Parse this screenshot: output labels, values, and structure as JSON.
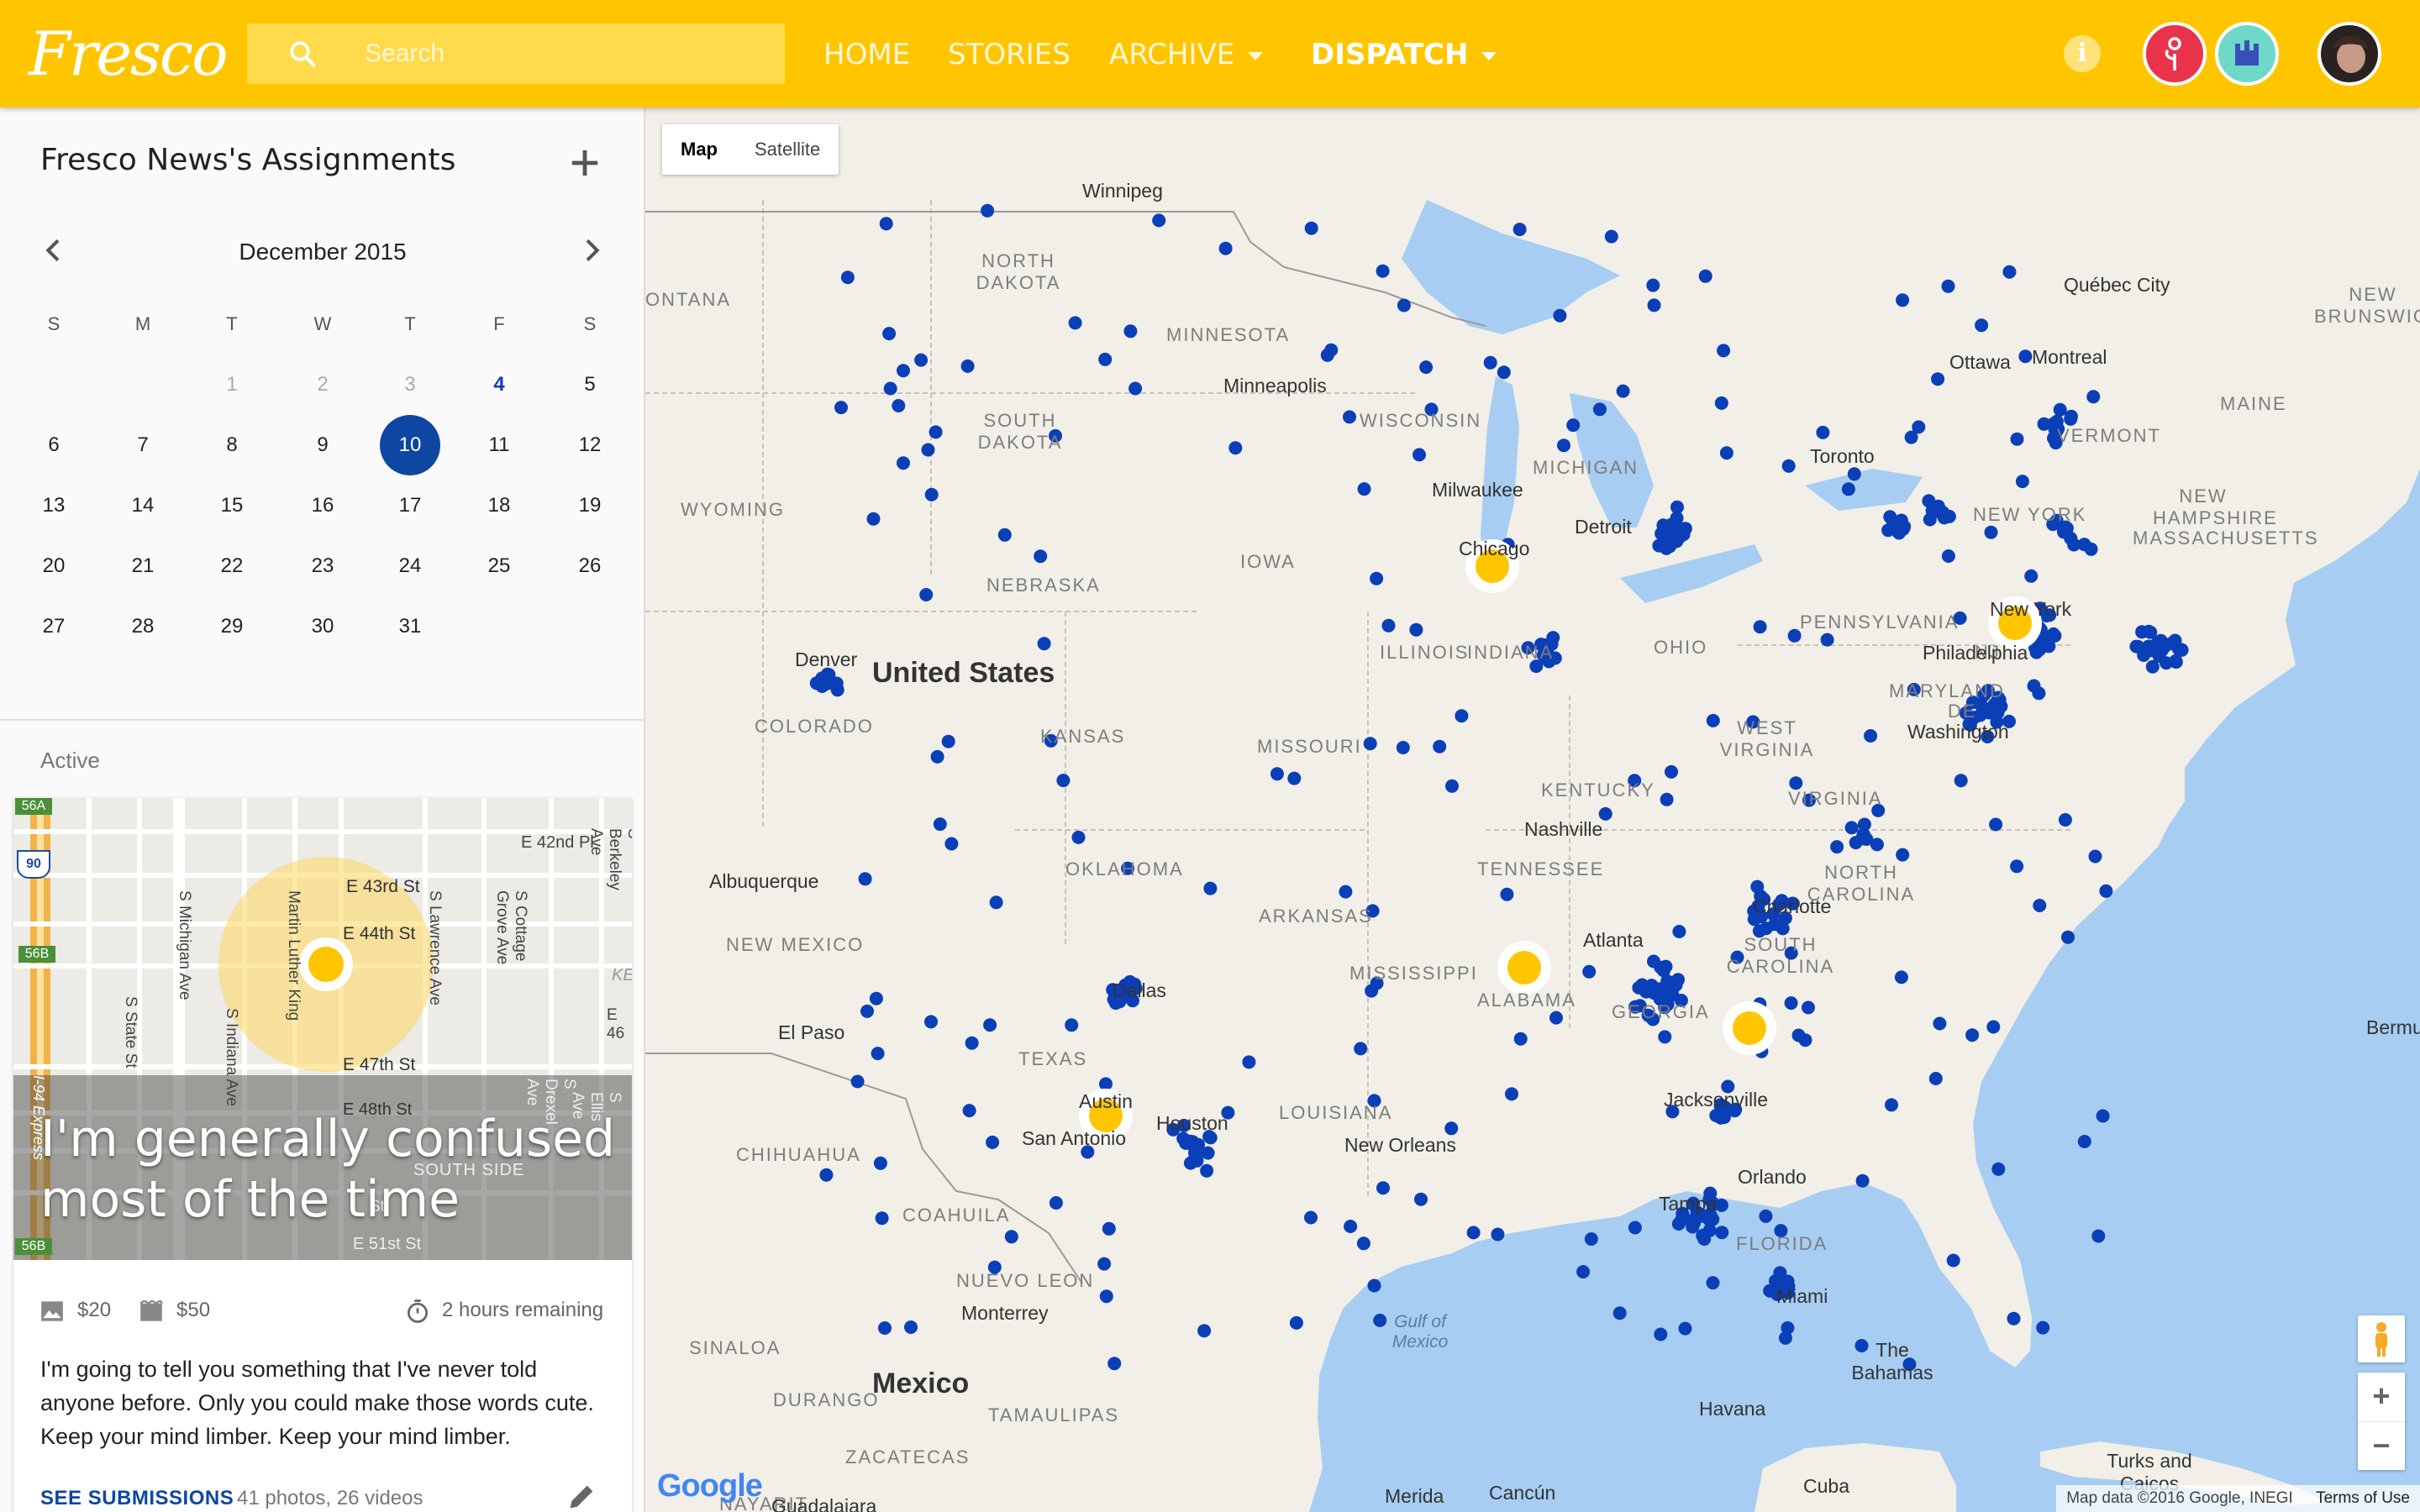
{
  "app": {
    "logo_text": "Fresco"
  },
  "header": {
    "search_placeholder": "Search",
    "nav": [
      {
        "label": "HOME",
        "active": false,
        "dropdown": false
      },
      {
        "label": "STORIES",
        "active": false,
        "dropdown": false
      },
      {
        "label": "ARCHIVE",
        "active": false,
        "dropdown": true
      },
      {
        "label": "DISPATCH",
        "active": true,
        "dropdown": true
      }
    ],
    "info_icon": "i"
  },
  "sidebar": {
    "title": "Fresco News's Assignments",
    "calendar": {
      "month_label": "December 2015",
      "weekdays": [
        "S",
        "M",
        "T",
        "W",
        "T",
        "F",
        "S"
      ],
      "rows": [
        [
          "",
          "",
          "1",
          "2",
          "3",
          "4",
          "5"
        ],
        [
          "6",
          "7",
          "8",
          "9",
          "10",
          "11",
          "12"
        ],
        [
          "13",
          "14",
          "15",
          "16",
          "17",
          "18",
          "19"
        ],
        [
          "20",
          "21",
          "22",
          "23",
          "24",
          "25",
          "26"
        ],
        [
          "27",
          "28",
          "29",
          "30",
          "31",
          "",
          ""
        ]
      ],
      "dimmed_days": [
        "1",
        "2",
        "3"
      ],
      "highlight_day": "4",
      "selected_day": "10"
    },
    "active_section_label": "Active",
    "assignment": {
      "title": "I'm generally confused most of the time",
      "photo_price": "$20",
      "video_price": "$50",
      "time_remaining": "2 hours remaining",
      "body": "I'm going to tell you something that I've never told anyone before. Only you could make those words cute. Keep your mind limber. Keep your mind limber.",
      "see_submissions_label": "SEE SUBMISSIONS",
      "submission_counts": "41 photos, 26 videos",
      "map_labels": {
        "streets": [
          "E 42nd Pl",
          "E 43rd St",
          "E 44th St",
          "E 47th St",
          "E 48th St",
          "E 51st St",
          "Martin Luther King",
          "S Michigan Ave",
          "S Indiana Ave",
          "S State St",
          "S Lawrence Ave",
          "S Cottage Grove Ave",
          "S Berkeley Ave",
          "S Drexel Ave",
          "S Ellis Ave",
          "I-94 Express"
        ],
        "district": "SOUTH SIDE",
        "shields": [
          "56A",
          "90",
          "56B",
          "56B"
        ],
        "fragments": [
          "KE",
          "E 46",
          "St"
        ]
      }
    }
  },
  "map": {
    "type_buttons": [
      {
        "label": "Map",
        "active": true
      },
      {
        "label": "Satellite",
        "active": false
      }
    ],
    "country_labels": [
      "United States",
      "Mexico"
    ],
    "state_labels": [
      "NORTH DAKOTA",
      "SOUTH DAKOTA",
      "MINNESOTA",
      "WISCONSIN",
      "MICHIGAN",
      "WYOMING",
      "NEBRASKA",
      "IOWA",
      "ILLINOIS",
      "INDIANA",
      "OHIO",
      "PENNSYLVANIA",
      "NEW YORK",
      "VERMONT",
      "NEW HAMPSHIRE",
      "MAINE",
      "MASSACHUSETTS",
      "COLORADO",
      "KANSAS",
      "MISSOURI",
      "KENTUCKY",
      "WEST VIRGINIA",
      "VIRGINIA",
      "MARYLAND",
      "DE",
      "NEW MEXICO",
      "OKLAHOMA",
      "ARKANSAS",
      "TENNESSEE",
      "NORTH CAROLINA",
      "SOUTH CAROLINA",
      "MISSISSIPPI",
      "ALABAMA",
      "GEORGIA",
      "TEXAS",
      "LOUISIANA",
      "FLORIDA",
      "NEW BRUNSWICK",
      "ONTANA",
      "CHIHUAHUA",
      "COAHUILA",
      "NUEVO LEON",
      "SINALOA",
      "DURANGO",
      "TAMAULIPAS",
      "ZACATECAS",
      "NAYARIT",
      "NJ"
    ],
    "city_labels": [
      "Winnipeg",
      "Minneapolis",
      "Milwaukee",
      "Chicago",
      "Detroit",
      "Toronto",
      "Ottawa",
      "Montreal",
      "Québec City",
      "Denver",
      "Albuquerque",
      "El Paso",
      "Dallas",
      "San Antonio",
      "Houston",
      "Austin",
      "New Orleans",
      "Nashville",
      "Atlanta",
      "Charlotte",
      "Washington",
      "Philadelphia",
      "New York",
      "Jacksonville",
      "Orlando",
      "Tampa",
      "Miami",
      "Monterrey",
      "Havana",
      "The Bahamas",
      "Bermuda",
      "Turks and Caicos",
      "Cuba",
      "Merida",
      "Cancún",
      "Guadalajara"
    ],
    "water_labels": [
      "Gulf of Mexico"
    ],
    "zoom_in": "+",
    "zoom_out": "−",
    "google_logo": "Google",
    "attribution": "Map data ©2016 Google, INEGI",
    "terms": "Terms of Use",
    "colors": {
      "water": "#a7cdf2",
      "land": "#f1efe7",
      "submission_dot": "#0b3fb8",
      "assignment_marker": "#ffc600",
      "brand": "#ffc600"
    }
  }
}
